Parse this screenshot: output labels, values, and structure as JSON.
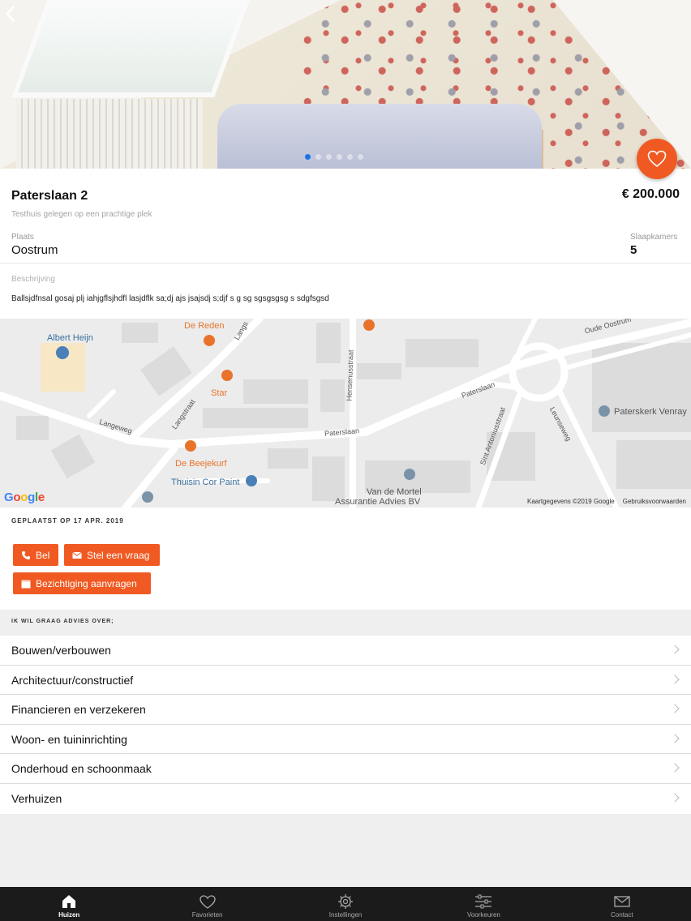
{
  "listing": {
    "title": "Paterslaan 2",
    "price": "€ 200.000",
    "subtitle": "Testhuis gelegen op een prachtige plek",
    "place_label": "Plaats",
    "place_value": "Oostrum",
    "bedrooms_label": "Slaapkamers",
    "bedrooms_value": "5",
    "description_label": "Beschrijving",
    "description_value": "Ballsjdfnsal gosaj plj iahjgflsjhdfl lasjdflk sa;dj ajs jsajsdj s;djf s g sg sgsgsgsg s sdgfsgsd",
    "photo_dots": 6,
    "active_photo": 1
  },
  "map": {
    "labels": {
      "albert_heijn": "Albert Heijn",
      "de_reden": "De Reden",
      "star": "Star",
      "de_beejekurf": "De Beejekurf",
      "thuisin": "Thuisin Cor Paint",
      "van_de_mortel_1": "Van de Mortel",
      "van_de_mortel_2": "Assurantie Advies BV",
      "paterskerk": "Paterskerk Venray",
      "langeweg": "Langeweg",
      "langstraat": "Langstraat",
      "langs_top": "Langs",
      "paterslaan_1": "Paterslaan",
      "paterslaan_2": "Paterslaan",
      "hensenius": "Hensenusstraat",
      "sint_antonius": "Sint Antoniusstraat",
      "leunseweg": "Leunseweg",
      "oude_oostrum": "Oude Oostrum"
    },
    "google": "Google",
    "attribution": "Kaartgegevens ©2019 Google",
    "terms": "Gebruiksvoorwaarden"
  },
  "actions": {
    "posted": "GEPLAATST OP 17 APR. 2019",
    "call_label": "Bel",
    "ask_label": "Stel een vraag",
    "viewing_label": "Bezichtiging aanvragen"
  },
  "advice": {
    "header": "IK WIL GRAAG ADVIES OVER;",
    "items": [
      {
        "label": "Bouwen/verbouwen"
      },
      {
        "label": "Architectuur/constructief"
      },
      {
        "label": "Financieren en verzekeren"
      },
      {
        "label": "Woon- en tuininrichting"
      },
      {
        "label": "Onderhoud en schoonmaak"
      },
      {
        "label": "Verhuizen"
      }
    ]
  },
  "tabs": [
    {
      "label": "Huizen",
      "icon": "home-icon",
      "active": true
    },
    {
      "label": "Favorieten",
      "icon": "heart-icon",
      "active": false
    },
    {
      "label": "Instellingen",
      "icon": "gear-icon",
      "active": false
    },
    {
      "label": "Voorkeuren",
      "icon": "sliders-icon",
      "active": false
    },
    {
      "label": "Contact",
      "icon": "mail-icon",
      "active": false
    }
  ],
  "colors": {
    "accent": "#f05a22",
    "tabbar": "#1b1b1b",
    "map_bg": "#ececec"
  }
}
